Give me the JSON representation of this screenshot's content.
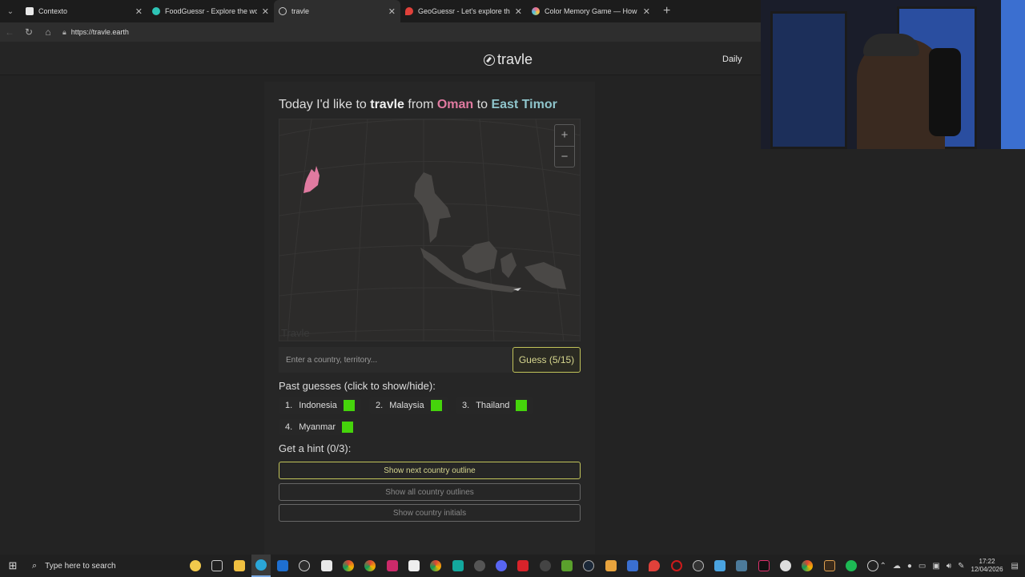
{
  "browser": {
    "tabs": [
      {
        "title": "Contexto",
        "color": "#e8e8e8"
      },
      {
        "title": "FoodGuessr - Explore the world b",
        "color": "#2ec4b6"
      },
      {
        "title": "travle",
        "color": "#cccccc"
      },
      {
        "title": "GeoGuessr - Let's explore the wo",
        "color": "#e0413a"
      },
      {
        "title": "Color Memory Game — How Well",
        "color": "#e96a9a"
      }
    ],
    "url": "https://travle.earth"
  },
  "site": {
    "logo": "travle",
    "nav_daily": "Daily"
  },
  "game": {
    "headline_prefix": "Today I'd like to",
    "headline_word": "travle",
    "headline_from": "from",
    "origin": "Oman",
    "headline_to": "to",
    "destination": "East Timor",
    "map_watermark": "Travle",
    "zoom_in": "+",
    "zoom_out": "−",
    "input_placeholder": "Enter a country, territory...",
    "guess_button": "Guess (5/15)",
    "past_title": "Past guesses (click to show/hide):",
    "guesses": [
      {
        "n": "1.",
        "name": "Indonesia",
        "status": "#45d40b"
      },
      {
        "n": "2.",
        "name": "Malaysia",
        "status": "#45d40b"
      },
      {
        "n": "3.",
        "name": "Thailand",
        "status": "#45d40b"
      },
      {
        "n": "4.",
        "name": "Myanmar",
        "status": "#45d40b"
      }
    ],
    "hint_title": "Get a hint (0/3):",
    "hints": [
      {
        "label": "Show next country outline",
        "enabled": true
      },
      {
        "label": "Show all country outlines",
        "enabled": false
      },
      {
        "label": "Show country initials",
        "enabled": false
      }
    ],
    "colors": {
      "origin": "#e07aa0",
      "destination": "#8fc5cc",
      "accent": "#c2c45a",
      "correct": "#45d40b"
    }
  },
  "taskbar": {
    "search_placeholder": "Type here to search",
    "time": "17:22",
    "date": "12/04/2026"
  }
}
